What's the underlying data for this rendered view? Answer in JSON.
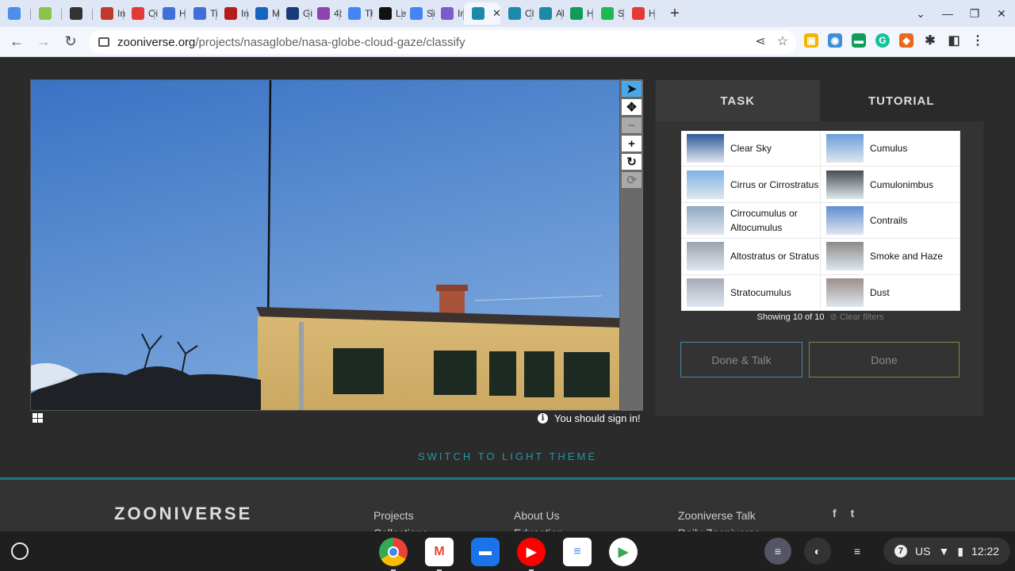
{
  "browser": {
    "tabs": [
      {
        "label": "",
        "color": "#4a8fe8"
      },
      {
        "label": "",
        "color": "#8bc34a"
      },
      {
        "label": "",
        "color": "#333333"
      },
      {
        "label": "In",
        "color": "#c0392b"
      },
      {
        "label": "Oi",
        "color": "#e53935"
      },
      {
        "label": "H",
        "color": "#3f6fd8"
      },
      {
        "label": "Ti",
        "color": "#3f6fd8"
      },
      {
        "label": "In",
        "color": "#b71c1c"
      },
      {
        "label": "M",
        "color": "#1565c0"
      },
      {
        "label": "Gi",
        "color": "#1a3a7a"
      },
      {
        "label": "4t",
        "color": "#8e44ad"
      },
      {
        "label": "Tł",
        "color": "#4285f4"
      },
      {
        "label": "Le",
        "color": "#111111"
      },
      {
        "label": "Si",
        "color": "#4285f4"
      },
      {
        "label": "In",
        "color": "#7b5cc9"
      },
      {
        "label": "",
        "color": "#1a8aa8",
        "active": true
      },
      {
        "label": "Cl",
        "color": "#1a8aa8"
      },
      {
        "label": "Al",
        "color": "#1a8aa8"
      },
      {
        "label": "H",
        "color": "#0f9d58"
      },
      {
        "label": "S",
        "color": "#1db954"
      },
      {
        "label": "H",
        "color": "#e53935"
      }
    ],
    "url_host": "zooniverse.org",
    "url_path": "/projects/nasaglobe/nasa-globe-cloud-gaze/classify"
  },
  "task_panel": {
    "tab_task": "TASK",
    "tab_tutorial": "TUTORIAL",
    "choices": [
      {
        "label": "Clear Sky",
        "thumb_color": "#2d5a96"
      },
      {
        "label": "Cumulus",
        "thumb_color": "#6a9ed8"
      },
      {
        "label": "Cirrus or Cirrostratus",
        "thumb_color": "#7fb2e6"
      },
      {
        "label": "Cumulonimbus",
        "thumb_color": "#4a4d52"
      },
      {
        "label": "Cirrocumulus or Altocumulus",
        "thumb_color": "#8fa9c2"
      },
      {
        "label": "Contrails",
        "thumb_color": "#5f8fd0"
      },
      {
        "label": "Altostratus or Stratus",
        "thumb_color": "#9aa3ad"
      },
      {
        "label": "Smoke and Haze",
        "thumb_color": "#8c8c86"
      },
      {
        "label": "Stratocumulus",
        "thumb_color": "#a4acb8"
      },
      {
        "label": "Dust",
        "thumb_color": "#9b8f8a"
      }
    ],
    "showing": "Showing 10 of 10",
    "clear_filters": "Clear filters",
    "done_talk": "Done & Talk",
    "done": "Done"
  },
  "subject": {
    "signin_text": "You should sign in!"
  },
  "theme_switch": "SWITCH TO LIGHT THEME",
  "footer": {
    "logo": "ZOONIVERSE",
    "col1": [
      "Projects",
      "Collections"
    ],
    "col2": [
      "About Us",
      "Education"
    ],
    "col3": [
      "Zooniverse Talk",
      "Daily Zooniverse"
    ],
    "social": [
      "f",
      "t"
    ]
  },
  "shelf": {
    "keyboard": "US",
    "notifications": "7",
    "time": "12:22"
  }
}
